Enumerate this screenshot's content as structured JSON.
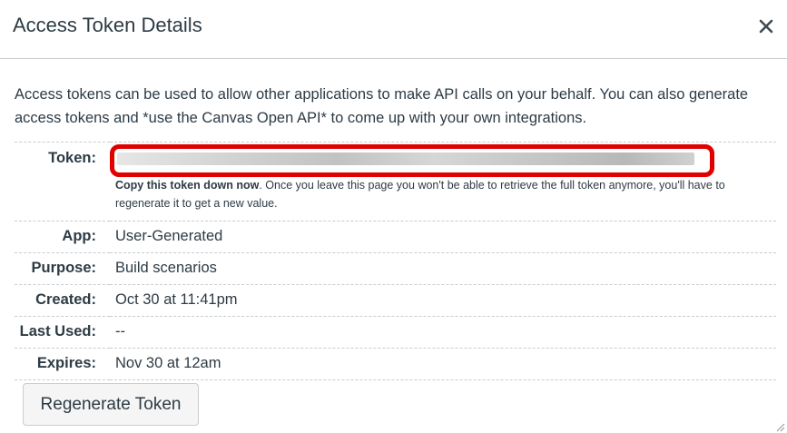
{
  "dialog": {
    "title": "Access Token Details",
    "close_icon": "close-icon"
  },
  "intro_text": "Access tokens can be used to allow other applications to make API calls on your behalf. You can also generate access tokens and *use the Canvas Open API* to come up with your own integrations.",
  "token": {
    "label": "Token:",
    "value_obscured": true,
    "note_strong": "Copy this token down now",
    "note_rest": ". Once you leave this page you won't be able to retrieve the full token anymore, you'll have to regenerate it to get a new value."
  },
  "details": [
    {
      "label": "App:",
      "value": "User-Generated"
    },
    {
      "label": "Purpose:",
      "value": "Build scenarios"
    },
    {
      "label": "Created:",
      "value": "Oct 30 at 11:41pm"
    },
    {
      "label": "Last Used:",
      "value": "--"
    },
    {
      "label": "Expires:",
      "value": "Nov 30 at 12am"
    }
  ],
  "actions": {
    "regenerate_label": "Regenerate Token"
  },
  "colors": {
    "text": "#2d3b45",
    "border": "#c7cdd1",
    "highlight": "#e00000",
    "button_bg": "#f5f5f5"
  }
}
